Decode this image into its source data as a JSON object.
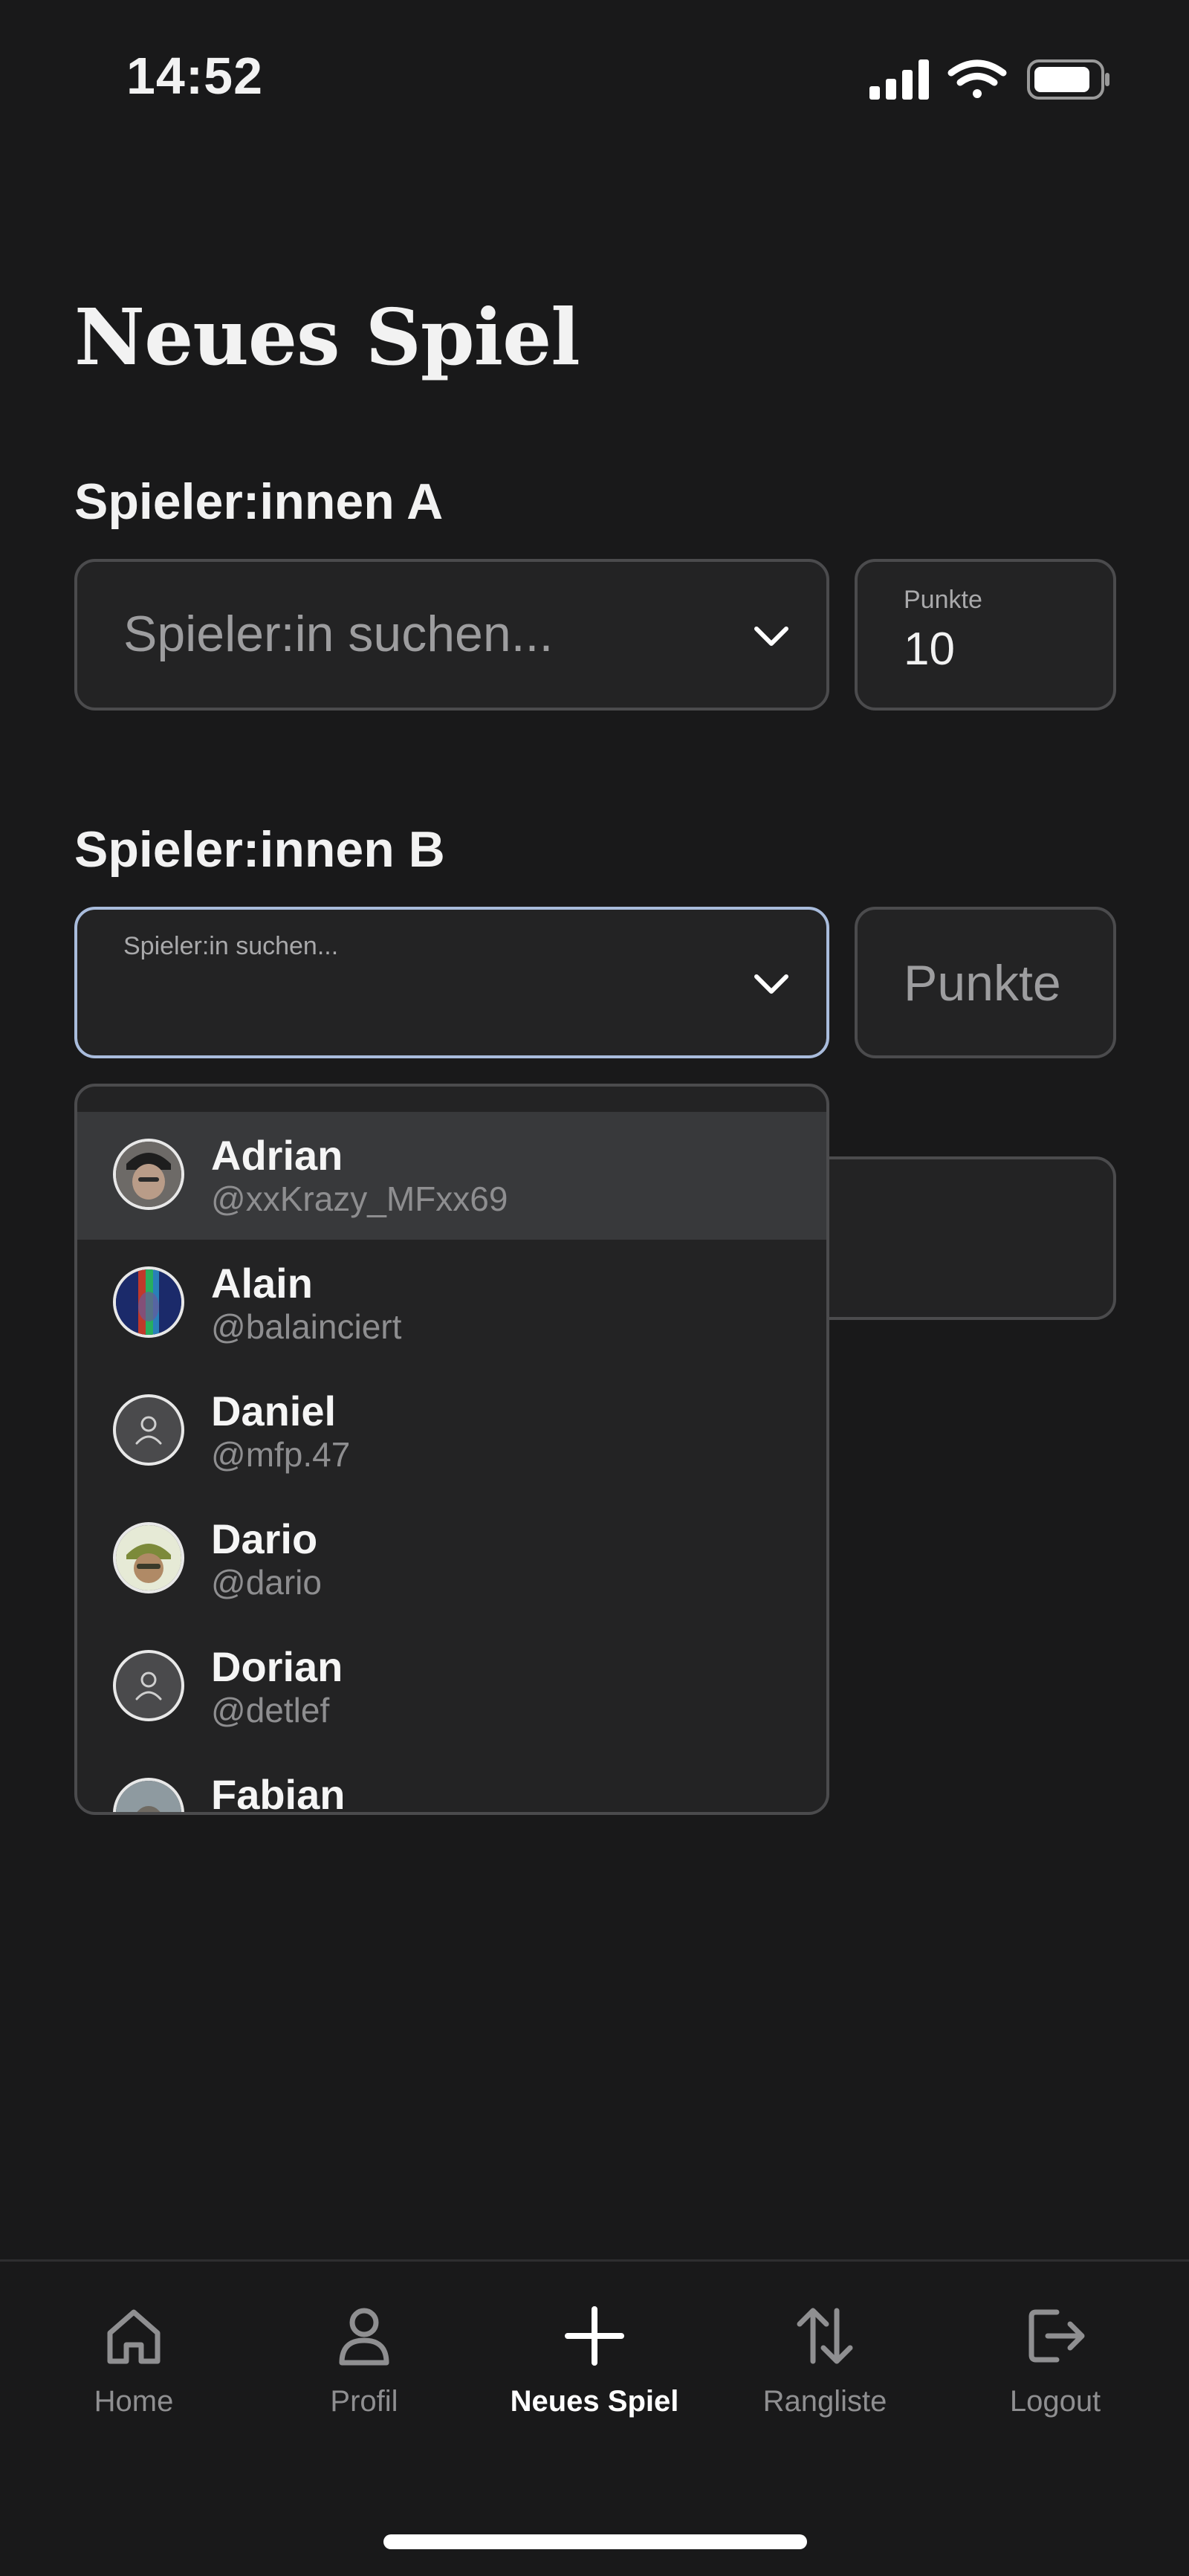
{
  "status_bar": {
    "time": "14:52"
  },
  "page": {
    "title": "Neues Spiel"
  },
  "team_a": {
    "label": "Spieler:innen A",
    "search_placeholder": "Spieler:in suchen...",
    "points_label": "Punkte",
    "points_value": "10"
  },
  "team_b": {
    "label": "Spieler:innen B",
    "search_floating_label": "Spieler:in suchen...",
    "points_placeholder": "Punkte"
  },
  "dropdown": {
    "options": [
      {
        "name": "Adrian",
        "handle": "@xxKrazy_MFxx69",
        "avatar": "photo",
        "highlighted": true
      },
      {
        "name": "Alain",
        "handle": "@balainciert",
        "avatar": "photo",
        "highlighted": false
      },
      {
        "name": "Daniel",
        "handle": "@mfp.47",
        "avatar": "default-user-icon",
        "highlighted": false
      },
      {
        "name": "Dario",
        "handle": "@dario",
        "avatar": "photo",
        "highlighted": false
      },
      {
        "name": "Dorian",
        "handle": "@detlef",
        "avatar": "default-user-icon",
        "highlighted": false
      },
      {
        "name": "Fabian",
        "handle": "",
        "avatar": "photo",
        "highlighted": false
      }
    ]
  },
  "tab_bar": {
    "tabs": [
      {
        "label": "Home",
        "icon": "home-icon",
        "active": false
      },
      {
        "label": "Profil",
        "icon": "user-icon",
        "active": false
      },
      {
        "label": "Neues Spiel",
        "icon": "plus-icon",
        "active": true
      },
      {
        "label": "Rangliste",
        "icon": "sort-arrows-icon",
        "active": false
      },
      {
        "label": "Logout",
        "icon": "logout-icon",
        "active": false
      }
    ]
  },
  "colors": {
    "background": "#19191a",
    "field": "#232324",
    "focus_border": "#a9bcdc",
    "highlight": "#38393b"
  }
}
